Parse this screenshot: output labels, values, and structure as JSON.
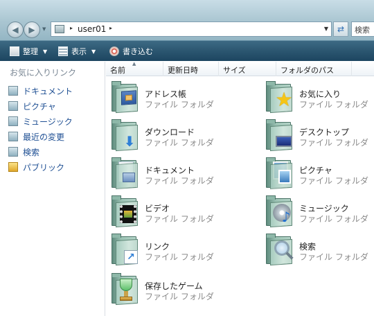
{
  "address": {
    "path": "user01",
    "sep": "▸",
    "search_placeholder": "検索"
  },
  "toolbar": {
    "organize_label": "整理",
    "view_label": "表示",
    "burn_label": "書き込む",
    "dropdown_glyph": "▼"
  },
  "navpane": {
    "header": "お気に入りリンク",
    "items": [
      {
        "label": "ドキュメント"
      },
      {
        "label": "ピクチャ"
      },
      {
        "label": "ミュージック"
      },
      {
        "label": "最近の変更"
      },
      {
        "label": "検索"
      },
      {
        "label": "パブリック"
      }
    ]
  },
  "columns": [
    {
      "label": "名前"
    },
    {
      "label": "更新日時"
    },
    {
      "label": "サイズ"
    },
    {
      "label": "フォルダのパス"
    }
  ],
  "folders": [
    {
      "name": "アドレス帳",
      "type": "ファイル フォルダ",
      "icon": "contacts-icon"
    },
    {
      "name": "お気に入り",
      "type": "ファイル フォルダ",
      "icon": "favorites-star-icon"
    },
    {
      "name": "ダウンロード",
      "type": "ファイル フォルダ",
      "icon": "downloads-arrow-icon"
    },
    {
      "name": "デスクトップ",
      "type": "ファイル フォルダ",
      "icon": "desktop-monitor-icon"
    },
    {
      "name": "ドキュメント",
      "type": "ファイル フォルダ",
      "icon": "documents-icon"
    },
    {
      "name": "ピクチャ",
      "type": "ファイル フォルダ",
      "icon": "pictures-icon"
    },
    {
      "name": "ビデオ",
      "type": "ファイル フォルダ",
      "icon": "videos-filmstrip-icon"
    },
    {
      "name": "ミュージック",
      "type": "ファイル フォルダ",
      "icon": "music-note-icon"
    },
    {
      "name": "リンク",
      "type": "ファイル フォルダ",
      "icon": "links-arrow-icon"
    },
    {
      "name": "検索",
      "type": "ファイル フォルダ",
      "icon": "searches-magnifier-icon"
    },
    {
      "name": "保存したゲーム",
      "type": "ファイル フォルダ",
      "icon": "saved-games-trophy-icon"
    }
  ]
}
